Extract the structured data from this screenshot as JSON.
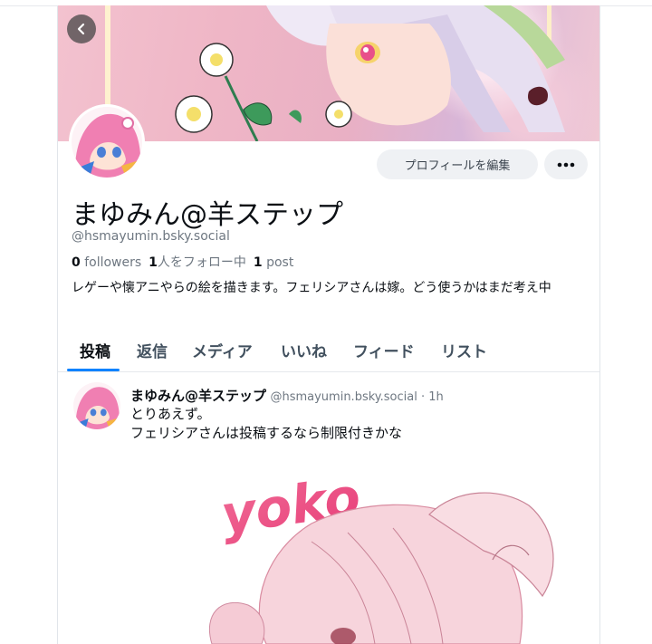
{
  "profile": {
    "display_name": "まゆみん@羊ステップ",
    "handle": "@hsmayumin.bsky.social",
    "followers_count": "0",
    "followers_label": "followers",
    "following_count": "1",
    "following_label": "人をフォロー中",
    "posts_count": "1",
    "posts_label": "post",
    "bio": "レゲーや懐アニやらの絵を描きます。フェリシアさんは嫁。どう使うかはまだ考え中",
    "edit_label": "プロフィールを編集"
  },
  "tabs": [
    {
      "label": "投稿",
      "active": true
    },
    {
      "label": "返信"
    },
    {
      "label": "メディア"
    },
    {
      "label": "いいね"
    },
    {
      "label": "フィード"
    },
    {
      "label": "リスト"
    }
  ],
  "post": {
    "author": "まゆみん@羊ステップ",
    "handle_time": "@hsmayumin.bsky.social · 1h",
    "line1": "とりあえず。",
    "line2": "フェリシアさんは投稿するなら制限付きかな",
    "image_text": "yoko"
  },
  "colors": {
    "accent": "#1083fe",
    "muted_text": "#6e7781",
    "button_bg": "#eff1f4"
  },
  "icons": [
    "back-arrow-icon",
    "more-dots-icon"
  ]
}
